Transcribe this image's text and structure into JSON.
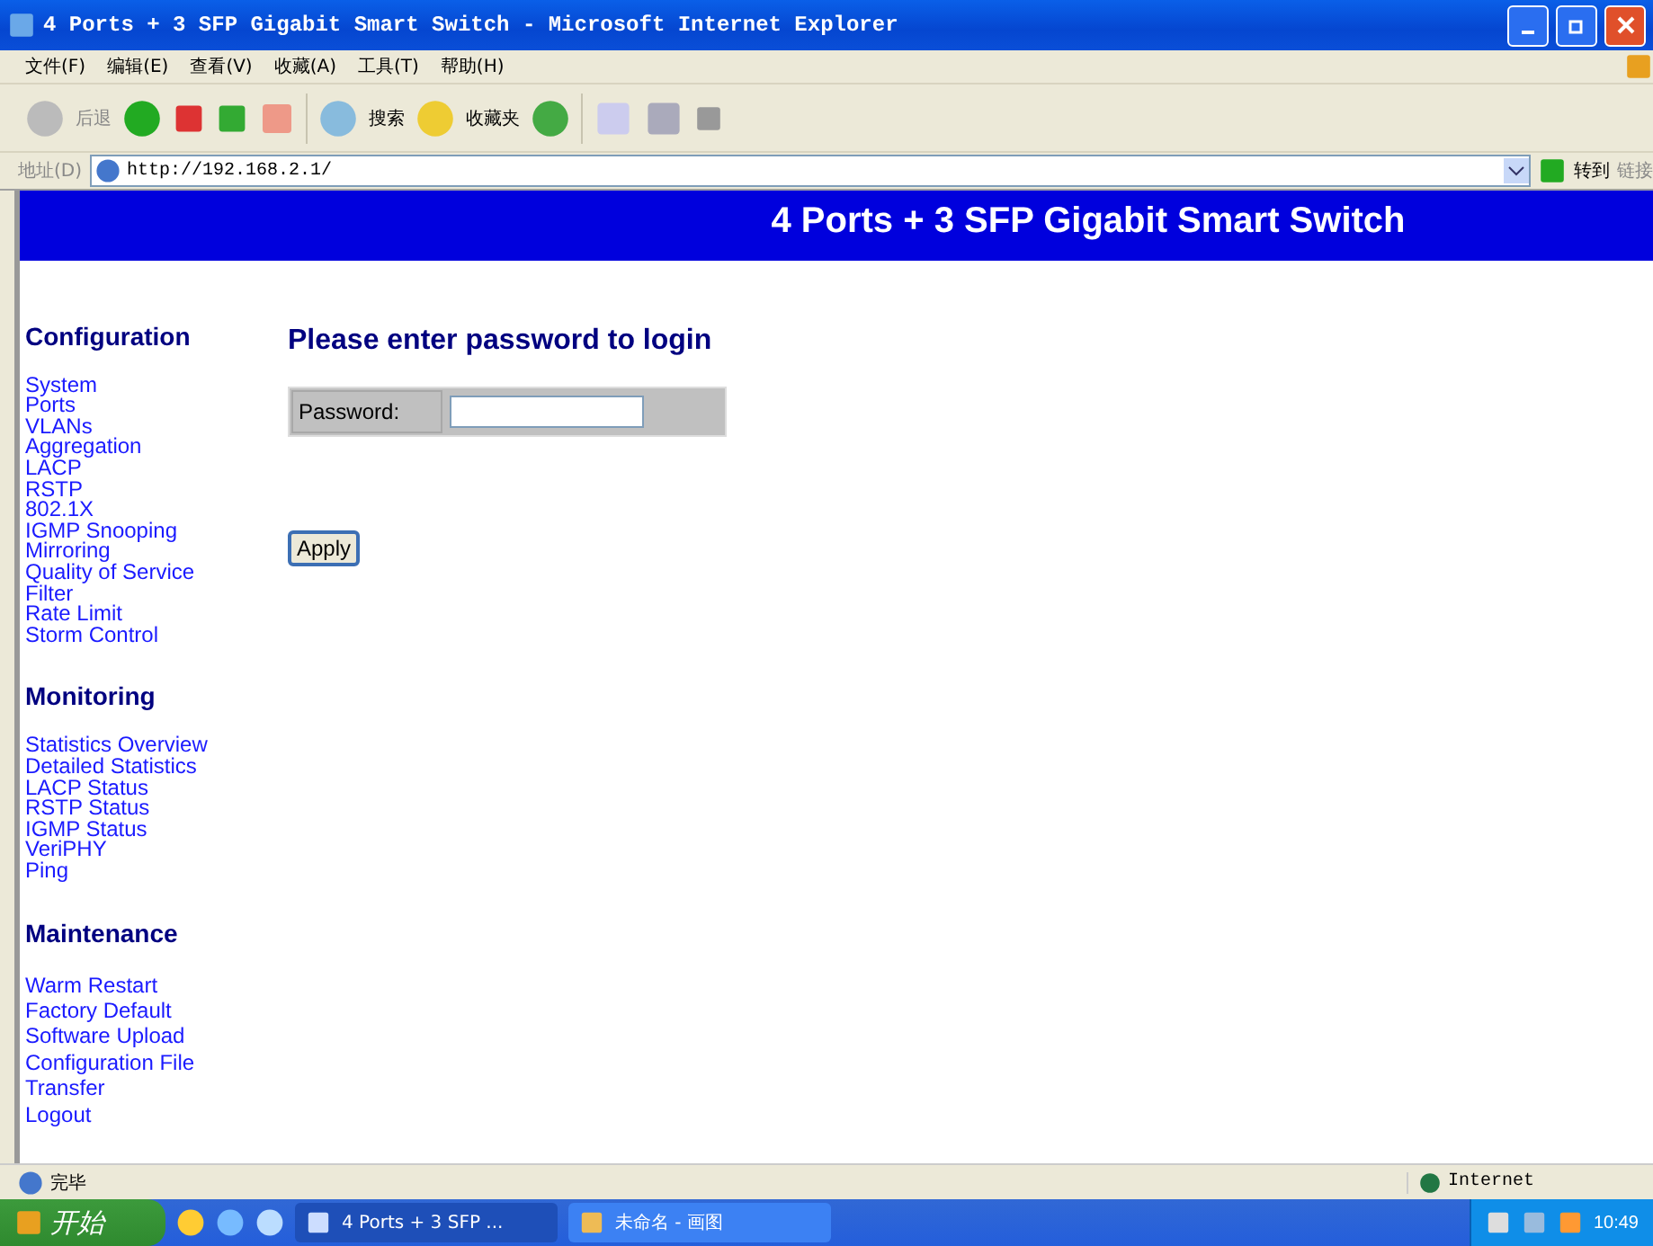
{
  "window": {
    "title": "4 Ports + 3 SFP Gigabit Smart Switch - Microsoft Internet Explorer"
  },
  "menu": [
    "文件(F)",
    "编辑(E)",
    "查看(V)",
    "收藏(A)",
    "工具(T)",
    "帮助(H)"
  ],
  "toolbar": {
    "back": "后退",
    "search": "搜索",
    "favorites": "收藏夹"
  },
  "address": {
    "label": "地址(D)",
    "value": "http://192.168.2.1/",
    "go": "转到",
    "links": "链接"
  },
  "banner": {
    "title": "4 Ports + 3 SFP Gigabit Smart Switch"
  },
  "sidebar": [
    {
      "heading": "Configuration",
      "items": [
        "System",
        "Ports",
        "VLANs",
        "Aggregation",
        "LACP",
        "RSTP",
        "802.1X",
        "IGMP Snooping",
        "Mirroring",
        "Quality of Service",
        "Filter",
        "Rate Limit",
        "Storm Control"
      ]
    },
    {
      "heading": "Monitoring",
      "items": [
        "Statistics Overview",
        "Detailed Statistics",
        "LACP Status",
        "RSTP Status",
        "IGMP Status",
        "VeriPHY",
        "Ping"
      ]
    },
    {
      "heading": "Maintenance",
      "items": [
        "Warm Restart",
        "Factory Default",
        "Software Upload",
        "Configuration File",
        "Transfer",
        "Logout"
      ]
    }
  ],
  "login": {
    "heading": "Please enter password to login",
    "label": "Password:",
    "button": "Apply"
  },
  "status_bar": {
    "text": "完毕",
    "zone": "Internet"
  },
  "taskbar": {
    "start": "开始",
    "windows": [
      {
        "title": "4 Ports + 3 SFP ...",
        "selected": true
      },
      {
        "title": "未命名 - 画图",
        "selected": false
      }
    ],
    "clock": "10:49"
  }
}
